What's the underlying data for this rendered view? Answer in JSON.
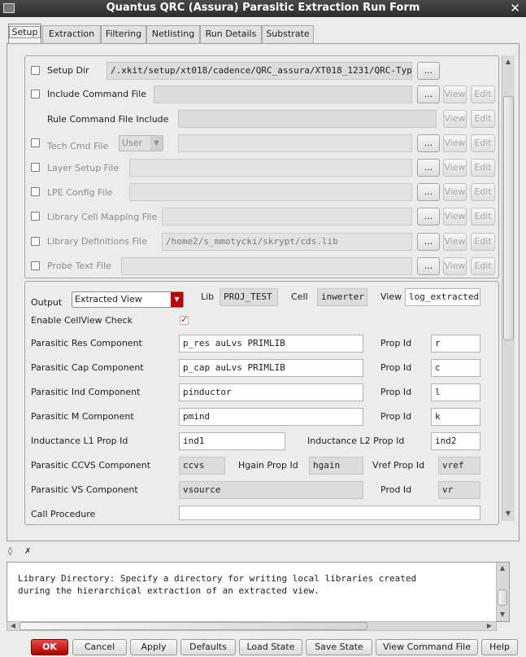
{
  "window": {
    "title": "Quantus QRC (Assura) Parasitic Extraction Run Form",
    "close": "✕"
  },
  "tabs": [
    "Setup",
    "Extraction",
    "Filtering",
    "Netlisting",
    "Run Details",
    "Substrate"
  ],
  "files": {
    "browse": "...",
    "view": "View",
    "edit": "Edit",
    "setup_dir": {
      "label": "Setup Dir",
      "value": "/.xkit/setup/xt018/cadence/QRC_assura/XT018_1231/QRC-Typ"
    },
    "include_cmd": {
      "label": "Include Command File",
      "value": ""
    },
    "rule_cmd": {
      "label": "Rule Command File Include",
      "value": ""
    },
    "tech_cmd": {
      "label": "Tech Cmd File",
      "dropdown": "User",
      "value": ""
    },
    "layer_setup": {
      "label": "Layer Setup File",
      "value": ""
    },
    "lpe_config": {
      "label": "LPE Config File",
      "value": ""
    },
    "lib_cell_map": {
      "label": "Library Cell Mapping File",
      "value": ""
    },
    "lib_defs": {
      "label": "Library Definitions File",
      "value": "/home2/s_mmotycki/skrypt/cds.lib"
    },
    "probe_text": {
      "label": "Probe Text File",
      "value": ""
    }
  },
  "output": {
    "label": "Output",
    "value": "Extracted View",
    "lib_label": "Lib",
    "lib": "PROJ_TEST",
    "cell_label": "Cell",
    "cell": "inwerter",
    "view_label": "View",
    "view": "log_extracted",
    "enable_cellview_label": "Enable CellView Check",
    "prop_id_label": "Prop Id",
    "res_label": "Parasitic Res Component",
    "res": "p_res auLvs PRIMLIB",
    "res_prop": "r",
    "cap_label": "Parasitic Cap Component",
    "cap": "p_cap auLvs PRIMLIB",
    "cap_prop": "c",
    "ind_label": "Parasitic Ind Component",
    "ind": "pinductor",
    "ind_prop": "l",
    "m_label": "Parasitic M Component",
    "m": "pmind",
    "m_prop": "k",
    "l1_label": "Inductance L1 Prop Id",
    "l1": "ind1",
    "l2_label": "Inductance L2 Prop Id",
    "l2": "ind2",
    "ccvs_label": "Parasitic CCVS Component",
    "ccvs": "ccvs",
    "hgain_label": "Hgain Prop Id",
    "hgain": "hgain",
    "vref_label": "Vref Prop Id",
    "vref": "vref",
    "vs_label": "Parasitic VS Component",
    "vs": "vsource",
    "prod_label": "Prod Id",
    "prod": "vr",
    "call_label": "Call Procedure",
    "call": ""
  },
  "message": "Library Directory: Specify a directory for writing local libraries created\nduring the hierarchical extraction of an extracted view.",
  "footer": {
    "ok": "OK",
    "cancel": "Cancel",
    "apply": "Apply",
    "defaults": "Defaults",
    "load_state": "Load State",
    "save_state": "Save State",
    "view_cmd": "View Command File",
    "help": "Help"
  },
  "colors": {
    "accent": "#b00000",
    "title_bg": "#333333"
  }
}
